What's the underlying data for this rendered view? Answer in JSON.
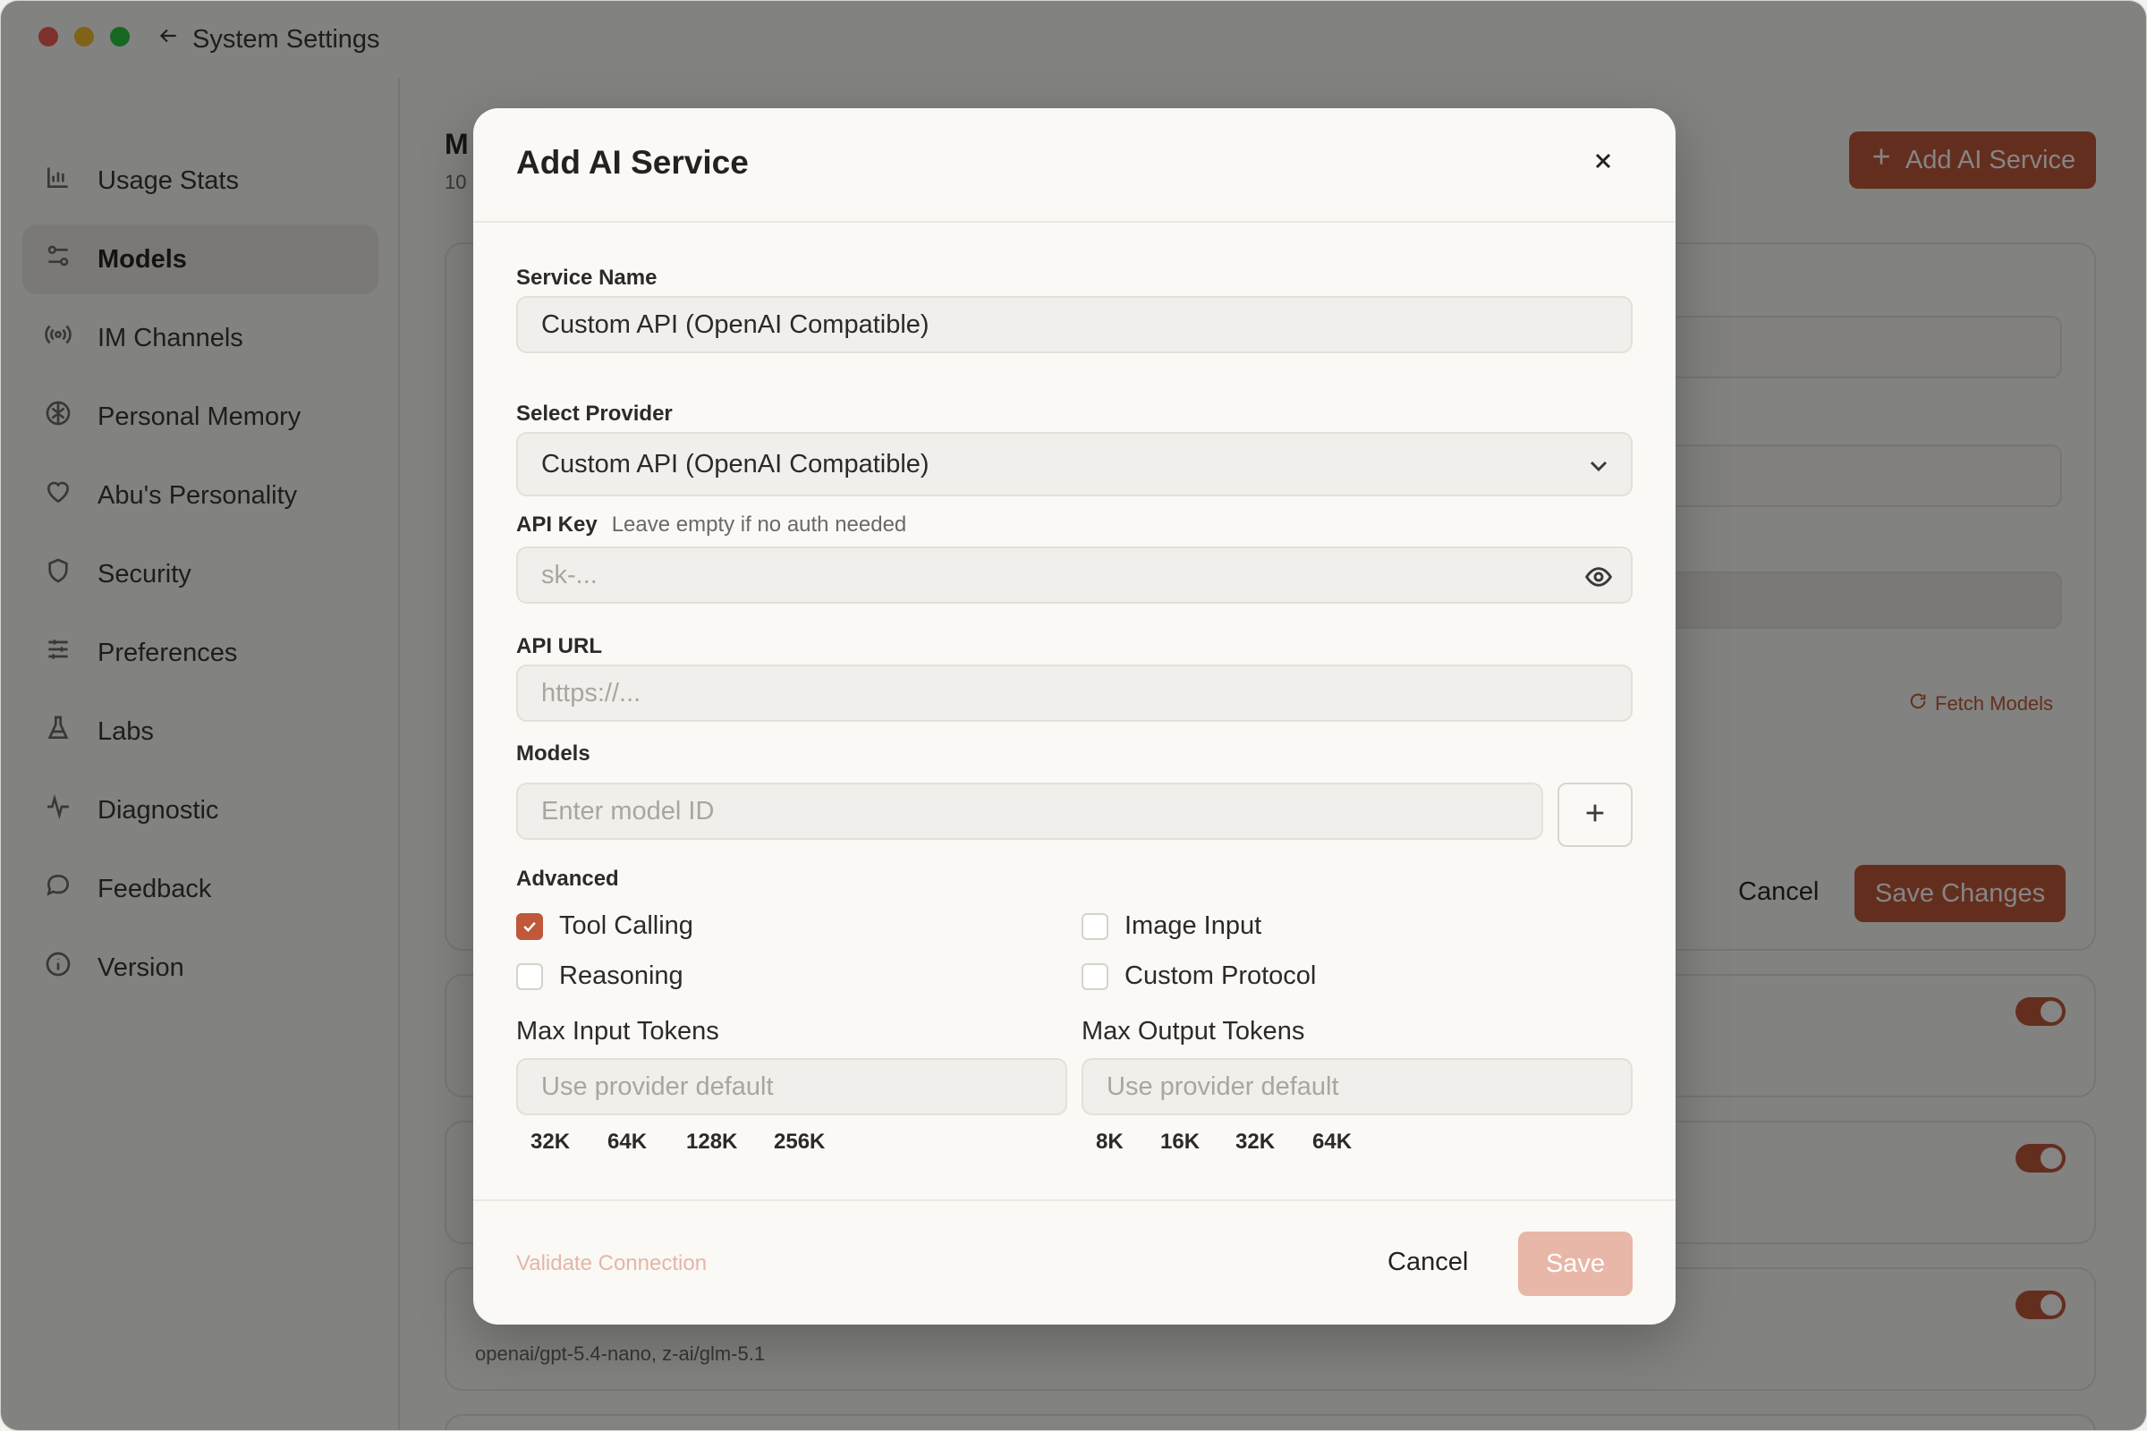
{
  "window": {
    "title": "System Settings"
  },
  "sidebar": {
    "items": [
      {
        "label": "Usage Stats",
        "icon": "bar-chart-icon"
      },
      {
        "label": "Models",
        "icon": "sliders-icon",
        "active": true
      },
      {
        "label": "IM Channels",
        "icon": "broadcast-icon"
      },
      {
        "label": "Personal Memory",
        "icon": "brain-icon"
      },
      {
        "label": "Abu's Personality",
        "icon": "heart-icon"
      },
      {
        "label": "Security",
        "icon": "shield-icon"
      },
      {
        "label": "Preferences",
        "icon": "tune-icon"
      },
      {
        "label": "Labs",
        "icon": "flask-icon"
      },
      {
        "label": "Diagnostic",
        "icon": "pulse-icon"
      },
      {
        "label": "Feedback",
        "icon": "chat-bubble-icon"
      },
      {
        "label": "Version",
        "icon": "info-icon"
      }
    ]
  },
  "main": {
    "title": "M",
    "subtitle": "10",
    "add_button": "Add AI Service",
    "fetch_models": "Fetch Models",
    "cancel": "Cancel",
    "save_changes": "Save Changes",
    "card_models": "openai/gpt-5.4-nano, z-ai/glm-5.1"
  },
  "modal": {
    "title": "Add AI Service",
    "service_name": {
      "label": "Service Name",
      "value": "Custom API (OpenAI Compatible)"
    },
    "provider": {
      "label": "Select Provider",
      "value": "Custom API (OpenAI Compatible)"
    },
    "api_key": {
      "label": "API Key",
      "hint": "Leave empty if no auth needed",
      "placeholder": "sk-..."
    },
    "api_url": {
      "label": "API URL",
      "placeholder": "https://..."
    },
    "models": {
      "label": "Models",
      "placeholder": "Enter model ID"
    },
    "advanced": {
      "label": "Advanced",
      "options": [
        {
          "label": "Tool Calling",
          "checked": true
        },
        {
          "label": "Image Input",
          "checked": false
        },
        {
          "label": "Reasoning",
          "checked": false
        },
        {
          "label": "Custom Protocol",
          "checked": false
        }
      ]
    },
    "max_input": {
      "label": "Max Input Tokens",
      "placeholder": "Use provider default",
      "presets": [
        "32K",
        "64K",
        "128K",
        "256K"
      ]
    },
    "max_output": {
      "label": "Max Output Tokens",
      "placeholder": "Use provider default",
      "presets": [
        "8K",
        "16K",
        "32K",
        "64K"
      ]
    },
    "footer": {
      "validate": "Validate Connection",
      "cancel": "Cancel",
      "save": "Save"
    }
  }
}
